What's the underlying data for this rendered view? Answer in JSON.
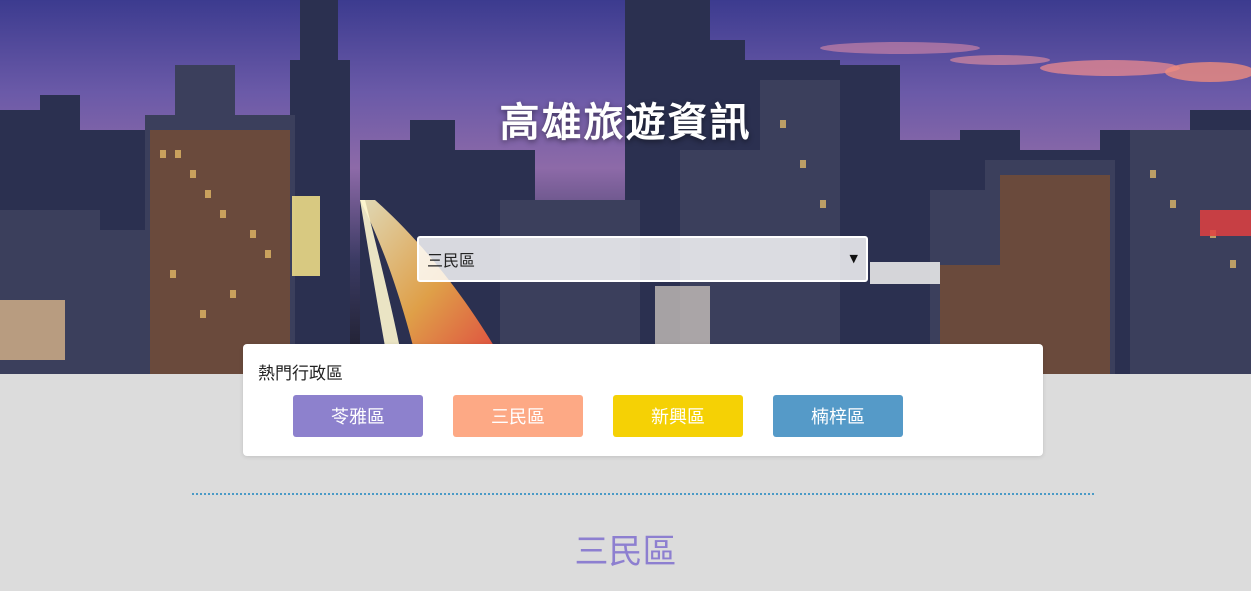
{
  "header": {
    "title": "高雄旅遊資訊"
  },
  "district_select": {
    "selected": "三民區"
  },
  "popular": {
    "title": "熱門行政區",
    "items": [
      {
        "label": "苓雅區",
        "color": "#8d81cd"
      },
      {
        "label": "三民區",
        "color": "#fda985"
      },
      {
        "label": "新興區",
        "color": "#f5d105"
      },
      {
        "label": "楠梓區",
        "color": "#559ac8"
      }
    ]
  },
  "current_district": {
    "name": "三民區",
    "color": "#8d7fd0"
  },
  "colors": {
    "divider": "#4a9ac6",
    "page_background": "#dcdcdc"
  }
}
